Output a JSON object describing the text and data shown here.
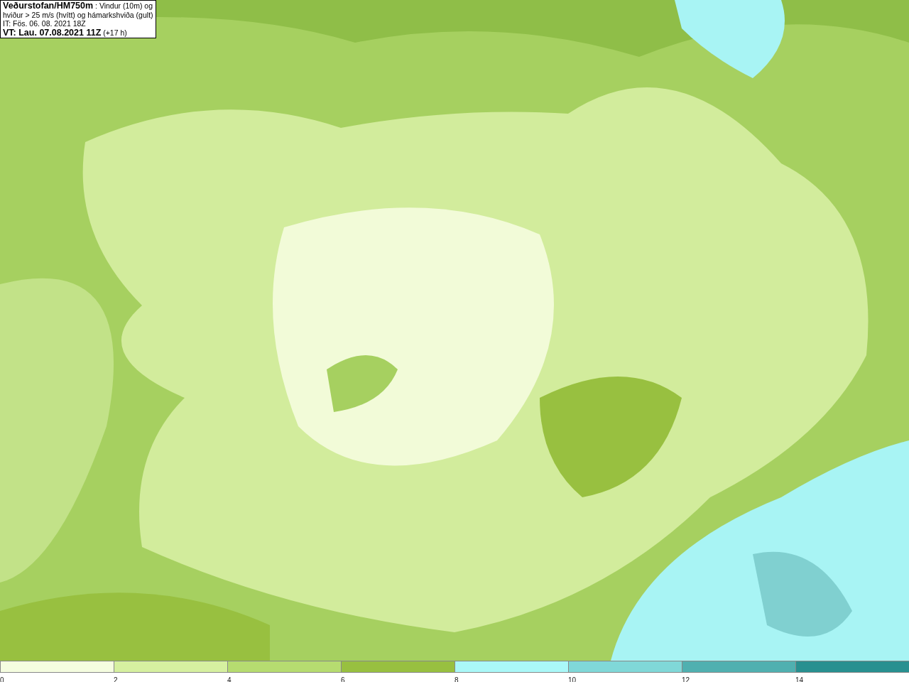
{
  "caption": {
    "lines": [
      "**Veðurstofan/HM750m** : Vindur (10m) og",
      "hviður > 25 m/s (hvítt) og hámarkshviða (gult)",
      "IT: Fös. 06. 08. 2021 18Z",
      "**VT: Lau. 07.08.2021 11Z** (+17 h)"
    ]
  },
  "legend": {
    "bins": [
      {
        "label": "0",
        "color": "#f5fde0"
      },
      {
        "label": "2",
        "color": "#d6f0a0"
      },
      {
        "label": "4",
        "color": "#b6dc70"
      },
      {
        "label": "6",
        "color": "#98c040"
      },
      {
        "label": "8",
        "color": "#aaf8f8"
      },
      {
        "label": "10",
        "color": "#80d8d8"
      },
      {
        "label": "12",
        "color": "#50b0b0"
      },
      {
        "label": "14",
        "color": "#289090"
      }
    ]
  }
}
